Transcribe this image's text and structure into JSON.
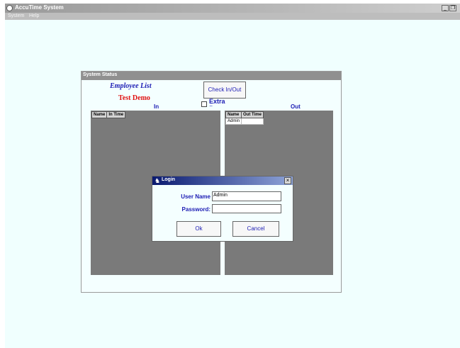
{
  "app": {
    "title": "AccuTime System",
    "window_buttons": {
      "minimize": "_",
      "restore": "❐"
    }
  },
  "menu": {
    "items": [
      "System",
      "Help"
    ]
  },
  "status_window": {
    "title": "System Status",
    "employee_list_label": "Employee List",
    "company_name": "Test Demo",
    "check_button": "Check In/Out",
    "extra_pay_label": "Extra Pay Itemf",
    "extra_pay_checked": false,
    "in_label": "In",
    "out_label": "Out",
    "in_table": {
      "headers": [
        "Name",
        "In Time"
      ],
      "rows": []
    },
    "out_table": {
      "headers": [
        "Name",
        "Out Time"
      ],
      "rows": [
        [
          "Admin",
          ""
        ]
      ]
    }
  },
  "login_dialog": {
    "title": "Login",
    "close_glyph": "×",
    "user_name_label": "User Name",
    "user_name_value": "Admin",
    "password_label": "Password:",
    "password_value": "",
    "ok_button": "Ok",
    "cancel_button": "Cancel"
  },
  "colors": {
    "background": "#f0fffe",
    "label_blue": "#1c1cb4",
    "company_red": "#e01010",
    "panel_gray": "#7a7a7a"
  }
}
